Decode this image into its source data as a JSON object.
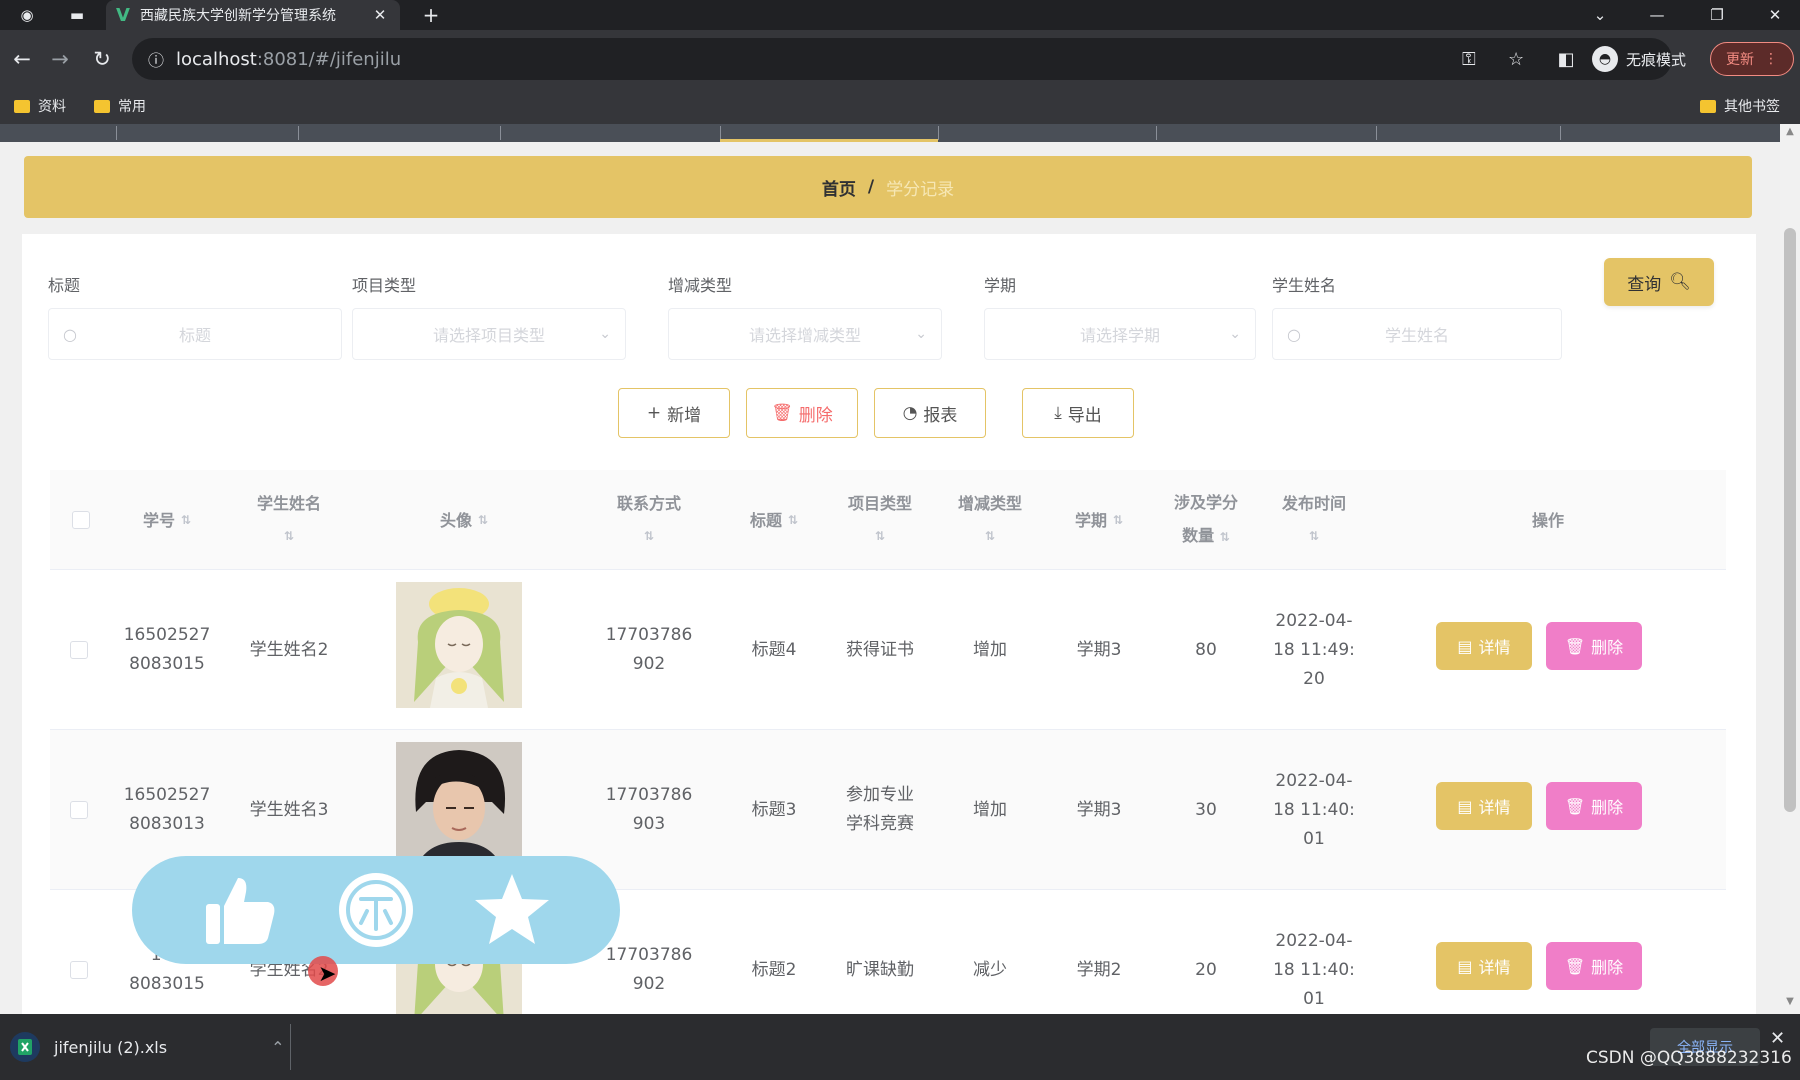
{
  "browser": {
    "tab_title": "西藏民族大学创新学分管理系统",
    "tab_favicon": "V",
    "new_tab": "+",
    "url_host": "localhost",
    "url_rest": ":8081/#/jifenjilu",
    "incognito_label": "无痕模式",
    "update_label": "更新",
    "bookmarks": [
      "资料",
      "常用"
    ],
    "other_bookmarks": "其他书签"
  },
  "breadcrumb": {
    "home": "首页",
    "separator": "/",
    "current": "学分记录"
  },
  "search": {
    "fields": [
      {
        "label": "标题",
        "placeholder": "标题"
      },
      {
        "label": "项目类型",
        "placeholder": "请选择项目类型"
      },
      {
        "label": "增减类型",
        "placeholder": "请选择增减类型"
      },
      {
        "label": "学期",
        "placeholder": "请选择学期"
      },
      {
        "label": "学生姓名",
        "placeholder": "学生姓名"
      }
    ],
    "query_label": "查询"
  },
  "actions": {
    "add": "新增",
    "delete": "删除",
    "report": "报表",
    "export": "导出"
  },
  "table": {
    "headers": {
      "student_no": "学号",
      "student_name": "学生姓名",
      "avatar": "头像",
      "contact": "联系方式",
      "title": "标题",
      "project_type": "项目类型",
      "change_type": "增减类型",
      "term": "学期",
      "credits_line1": "涉及学分",
      "credits_line2": "数量",
      "publish_time": "发布时间",
      "operation": "操作"
    },
    "rows": [
      {
        "student_no_1": "16502527",
        "student_no_2": "8083015",
        "student_name": "学生姓名2",
        "contact_1": "17703786",
        "contact_2": "902",
        "title": "标题4",
        "project_type_1": "获得证书",
        "project_type_2": "",
        "change_type": "增加",
        "term": "学期3",
        "credits": "80",
        "time_1": "2022-04-",
        "time_2": "18 11:49:",
        "time_3": "20"
      },
      {
        "student_no_1": "16502527",
        "student_no_2": "8083013",
        "student_name": "学生姓名3",
        "contact_1": "17703786",
        "contact_2": "903",
        "title": "标题3",
        "project_type_1": "参加专业",
        "project_type_2": "学科竞赛",
        "change_type": "增加",
        "term": "学期3",
        "credits": "30",
        "time_1": "2022-04-",
        "time_2": "18 11:40:",
        "time_3": "01"
      },
      {
        "student_no_1": "165",
        "student_no_2": "8083015",
        "student_name": "学生姓名2",
        "contact_1": "17703786",
        "contact_2": "902",
        "title": "标题2",
        "project_type_1": "旷课缺勤",
        "project_type_2": "",
        "change_type": "减少",
        "term": "学期2",
        "credits": "20",
        "time_1": "2022-04-",
        "time_2": "18 11:40:",
        "time_3": "01"
      }
    ],
    "detail_label": "详情",
    "delete_label": "删除"
  },
  "download": {
    "filename": "jifenjilu (2).xls",
    "show_all": "全部显示"
  },
  "watermark": "CSDN @QQ3888232316",
  "colors": {
    "accent": "#e4c466",
    "delete_pink": "#f07ec8",
    "overlay": "#9fd7ec"
  }
}
